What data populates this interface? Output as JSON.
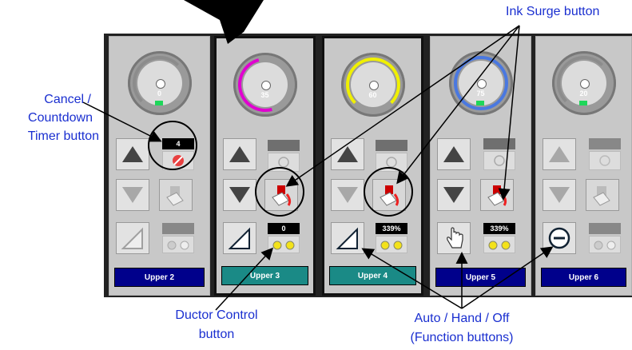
{
  "annotations": {
    "ink_surge": "Ink Surge button",
    "cancel_line1": "Cancel /",
    "cancel_line2": "Countdown",
    "cancel_line3": "Timer button",
    "ductor_line1": "Ductor Control",
    "ductor_line2": "button",
    "auto_line1": "Auto / Hand / Off",
    "auto_line2": "(Function buttons)"
  },
  "units": [
    {
      "label": "Upper 2",
      "label_color": "#00008b",
      "gauge_pct": "0",
      "arc_color": "#8c8c8c",
      "timer": "4",
      "display_value": "",
      "selected": false
    },
    {
      "label": "Upper 3",
      "label_color": "#1a8a86",
      "gauge_pct": "35",
      "arc_color": "#e000d0",
      "timer": "",
      "display_value": "0",
      "selected": true
    },
    {
      "label": "Upper 4",
      "label_color": "#1a8a86",
      "gauge_pct": "60",
      "arc_color": "#f0f000",
      "timer": "",
      "display_value": "339%",
      "selected": true
    },
    {
      "label": "Upper 5",
      "label_color": "#00008b",
      "gauge_pct": "75",
      "arc_color": "#4a78e0",
      "timer": "",
      "display_value": "339%",
      "selected": false
    },
    {
      "label": "Upper 6",
      "label_color": "#00008b",
      "gauge_pct": "20",
      "arc_color": "#8c8c8c",
      "timer": "",
      "display_value": "",
      "selected": false
    }
  ],
  "colors": {
    "annotation": "#1a2fd0",
    "led": "#1fd65a"
  }
}
